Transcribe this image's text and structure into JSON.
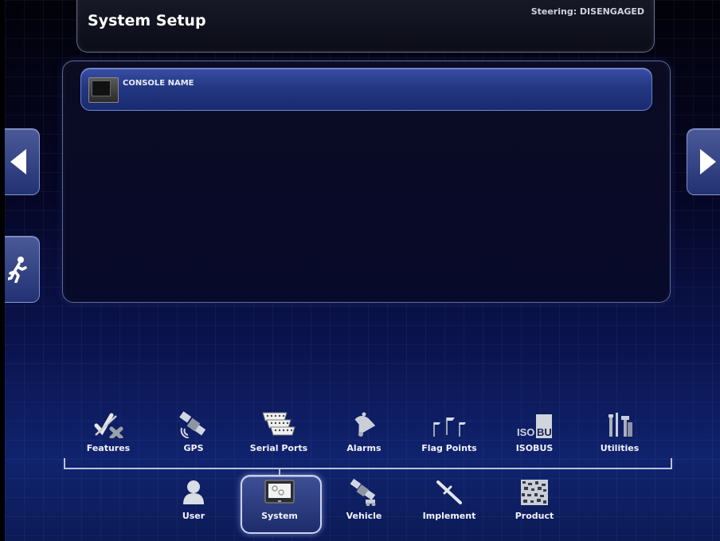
{
  "header": {
    "steering_status": "Steering: DISENGAGED",
    "title": "System Setup"
  },
  "main": {
    "items": [
      {
        "label": "CONSOLE NAME",
        "icon": "console-icon"
      }
    ]
  },
  "nav": {
    "prev_icon": "arrow-left-icon",
    "next_icon": "arrow-right-icon",
    "exit_icon": "running-man-exit-icon"
  },
  "system_menu": {
    "items": [
      {
        "label": "Features",
        "icon": "features-icon"
      },
      {
        "label": "GPS",
        "icon": "satellite-icon"
      },
      {
        "label": "Serial Ports",
        "icon": "serial-ports-icon"
      },
      {
        "label": "Alarms",
        "icon": "bell-icon"
      },
      {
        "label": "Flag Points",
        "icon": "flags-icon"
      },
      {
        "label": "ISOBUS",
        "icon": "isobus-icon",
        "icon_text": "ISOBUS"
      },
      {
        "label": "Utilities",
        "icon": "tools-icon"
      }
    ]
  },
  "main_menu": {
    "selected": "System",
    "items": [
      {
        "label": "User",
        "icon": "user-icon"
      },
      {
        "label": "System",
        "icon": "console-icon"
      },
      {
        "label": "Vehicle",
        "icon": "vehicle-satellite-icon"
      },
      {
        "label": "Implement",
        "icon": "implement-icon"
      },
      {
        "label": "Product",
        "icon": "product-icon"
      }
    ]
  },
  "colors": {
    "accent": "#233783",
    "border": "#b9c2dc",
    "background_top": "#02020a",
    "background_bottom": "#10236e"
  }
}
